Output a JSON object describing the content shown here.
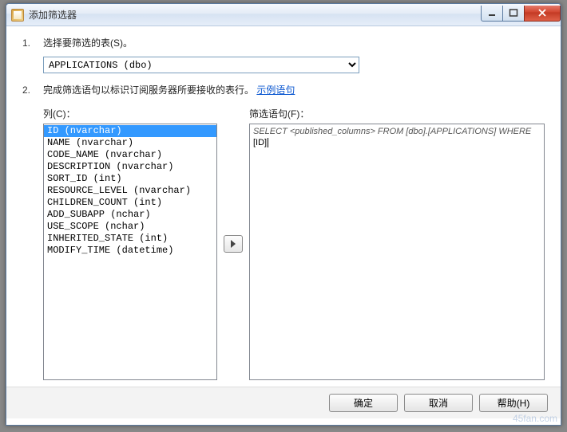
{
  "window": {
    "title": "添加筛选器"
  },
  "step1": {
    "num": "1.",
    "text": "选择要筛选的表(S)。",
    "combo_value": "APPLICATIONS (dbo)"
  },
  "step2": {
    "num": "2.",
    "text_prefix": "完成筛选语句以标识订阅服务器所要接收的表行。",
    "link": "示例语句"
  },
  "columns": {
    "label": "列(C)：",
    "items": [
      "ID (nvarchar)",
      "NAME (nvarchar)",
      "CODE_NAME (nvarchar)",
      "DESCRIPTION (nvarchar)",
      "SORT_ID (int)",
      "RESOURCE_LEVEL (nvarchar)",
      "CHILDREN_COUNT (int)",
      "ADD_SUBAPP (nchar)",
      "USE_SCOPE (nchar)",
      "INHERITED_STATE (int)",
      "MODIFY_TIME (datetime)"
    ],
    "selected_index": 0
  },
  "filter": {
    "label": "筛选语句(F)：",
    "italic": "SELECT <published_columns> FROM [dbo].[APPLICATIONS] WHERE",
    "normal": "[ID]"
  },
  "buttons": {
    "ok": "确定",
    "cancel": "取消",
    "help": "帮助(H)"
  },
  "watermark": "45fan.com"
}
